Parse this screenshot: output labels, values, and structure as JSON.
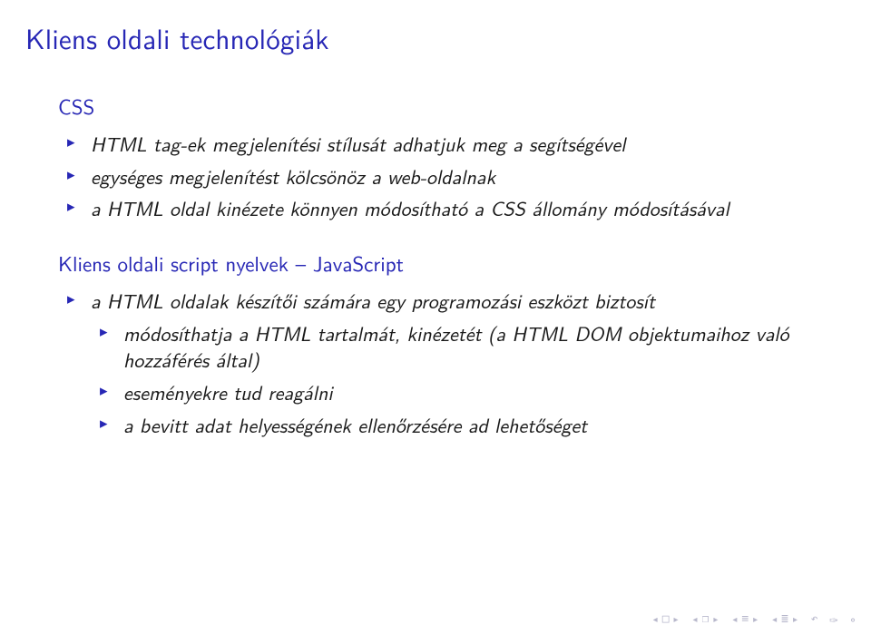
{
  "title": "Kliens oldali technológiák",
  "block1": {
    "heading": "CSS",
    "items": [
      "HTML tag-ek megjelenítési stílusát adhatjuk meg a segítségével",
      "egységes megjelenítést kölcsönöz a web-oldalnak",
      "a HTML oldal kinézete könnyen módosítható a CSS állomány módosításával"
    ]
  },
  "block2": {
    "heading": "Kliens oldali script nyelvek – JavaScript",
    "items": [
      {
        "text": "a HTML oldalak készítői számára egy programozási eszközt biztosít",
        "sub": [
          "módosíthatja a HTML tartalmát, kinézetét (a HTML DOM objektumaihoz való hozzáférés által)",
          "eseményekre tud reagálni",
          "a bevitt adat helyességének ellenőrzésére ad lehetőséget"
        ]
      }
    ]
  },
  "nav": {
    "first_left": "◂",
    "first_right": "▸",
    "frame_left": "◂",
    "frame_right": "▸",
    "sub_left": "◂",
    "sub_right": "▸",
    "step_left": "◂",
    "step_right": "▸",
    "back": "↶",
    "circ": "✑",
    "quit": "⚬"
  }
}
